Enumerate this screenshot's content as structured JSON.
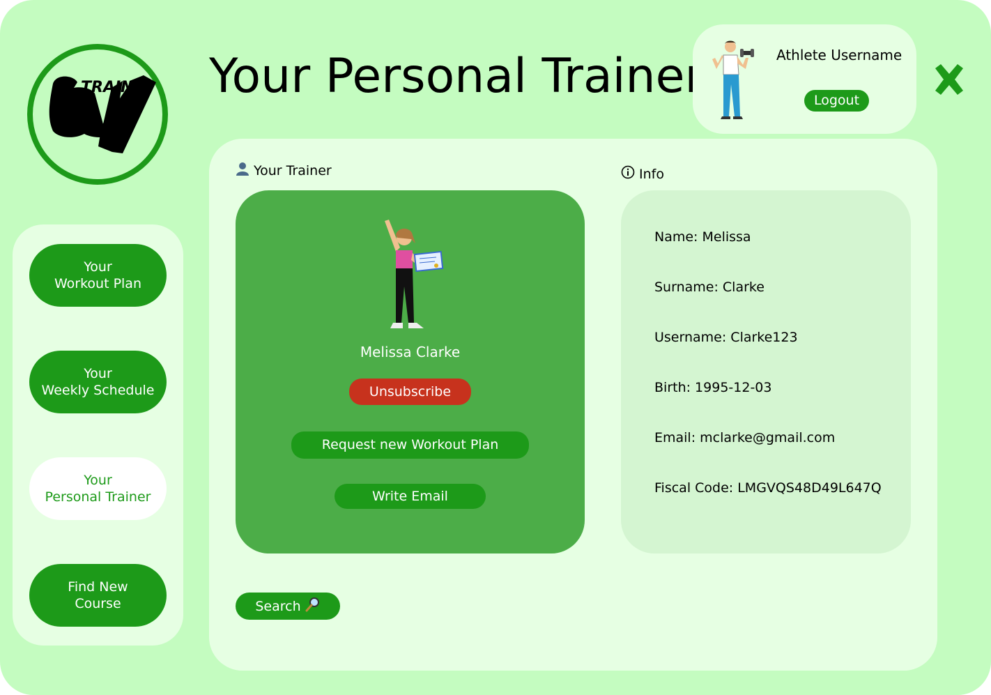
{
  "app": {
    "title": "Your Personal Trainer",
    "logo_text": "TRAIN"
  },
  "user": {
    "username": "Athlete Username",
    "logout_label": "Logout"
  },
  "sidebar": {
    "items": [
      {
        "line1": "Your",
        "line2": "Workout Plan",
        "active": false
      },
      {
        "line1": "Your",
        "line2": "Weekly Schedule",
        "active": false
      },
      {
        "line1": "Your",
        "line2": "Personal Trainer",
        "active": true
      },
      {
        "line1": "Find New",
        "line2": "Course",
        "active": false
      }
    ]
  },
  "trainer_section": {
    "label": "Your Trainer",
    "name": "Melissa Clarke",
    "unsubscribe_label": "Unsubscribe",
    "request_plan_label": "Request new Workout Plan",
    "write_email_label": "Write Email"
  },
  "info_section": {
    "label": "Info",
    "rows": [
      "Name: Melissa",
      "Surname: Clarke",
      "Username: Clarke123",
      "Birth: 1995-12-03",
      "Email: mclarke@gmail.com",
      "Fiscal Code: LMGVQS48D49L647Q"
    ]
  },
  "search": {
    "label": "Search"
  },
  "icons": {
    "user": "user-icon",
    "info": "info-icon",
    "search": "magnifier-icon",
    "close": "close-icon"
  },
  "colors": {
    "background": "#c4fcc0",
    "panel": "#e6ffe3",
    "primary": "#1d9a19",
    "trainer_card": "#4cad48",
    "info_card": "#d4f5d1",
    "danger": "#c7321d"
  }
}
